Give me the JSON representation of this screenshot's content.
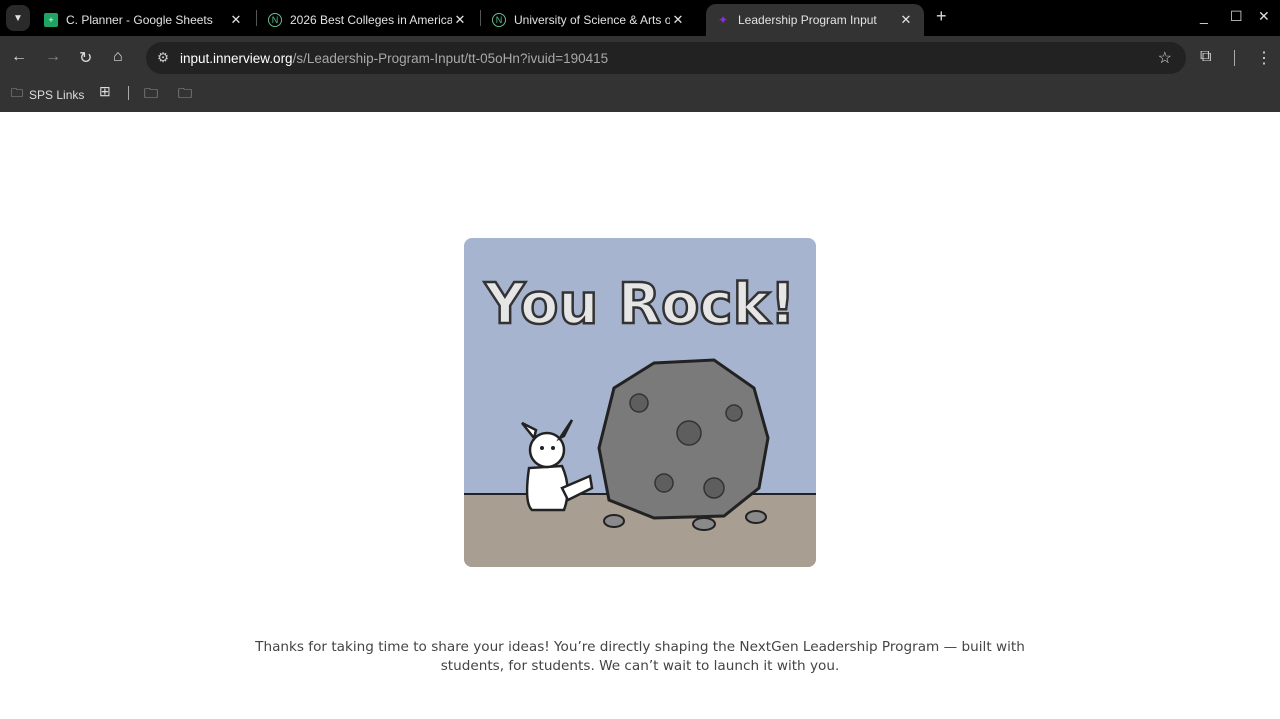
{
  "tabs": [
    {
      "title": "C. Planner - Google Sheets",
      "icon": "google-sheets-icon",
      "color": "#1fa463"
    },
    {
      "title": "2026 Best Colleges in America",
      "icon": "niche-icon",
      "color": "#5fbf8f"
    },
    {
      "title": "University of Science & Arts of Oklahoma",
      "icon": "niche-icon",
      "color": "#5fbf8f"
    },
    {
      "title": "Leadership Program Input",
      "icon": "innerview-icon",
      "color": "#8a2be2",
      "active": true
    }
  ],
  "address": {
    "host": "input.innerview.org",
    "path": "/s/Leadership-Program-Input/tt-05oHn?ivuid=190415"
  },
  "bookmarks": {
    "sps": "SPS Links"
  },
  "hero": {
    "lettering": "You Rock!"
  },
  "message": {
    "line1": "Thanks for taking  time to share your ideas! You’re directly shaping the NextGen Leadership Program — built with",
    "line2": "students, for students. We can’t wait to launch it with you."
  }
}
